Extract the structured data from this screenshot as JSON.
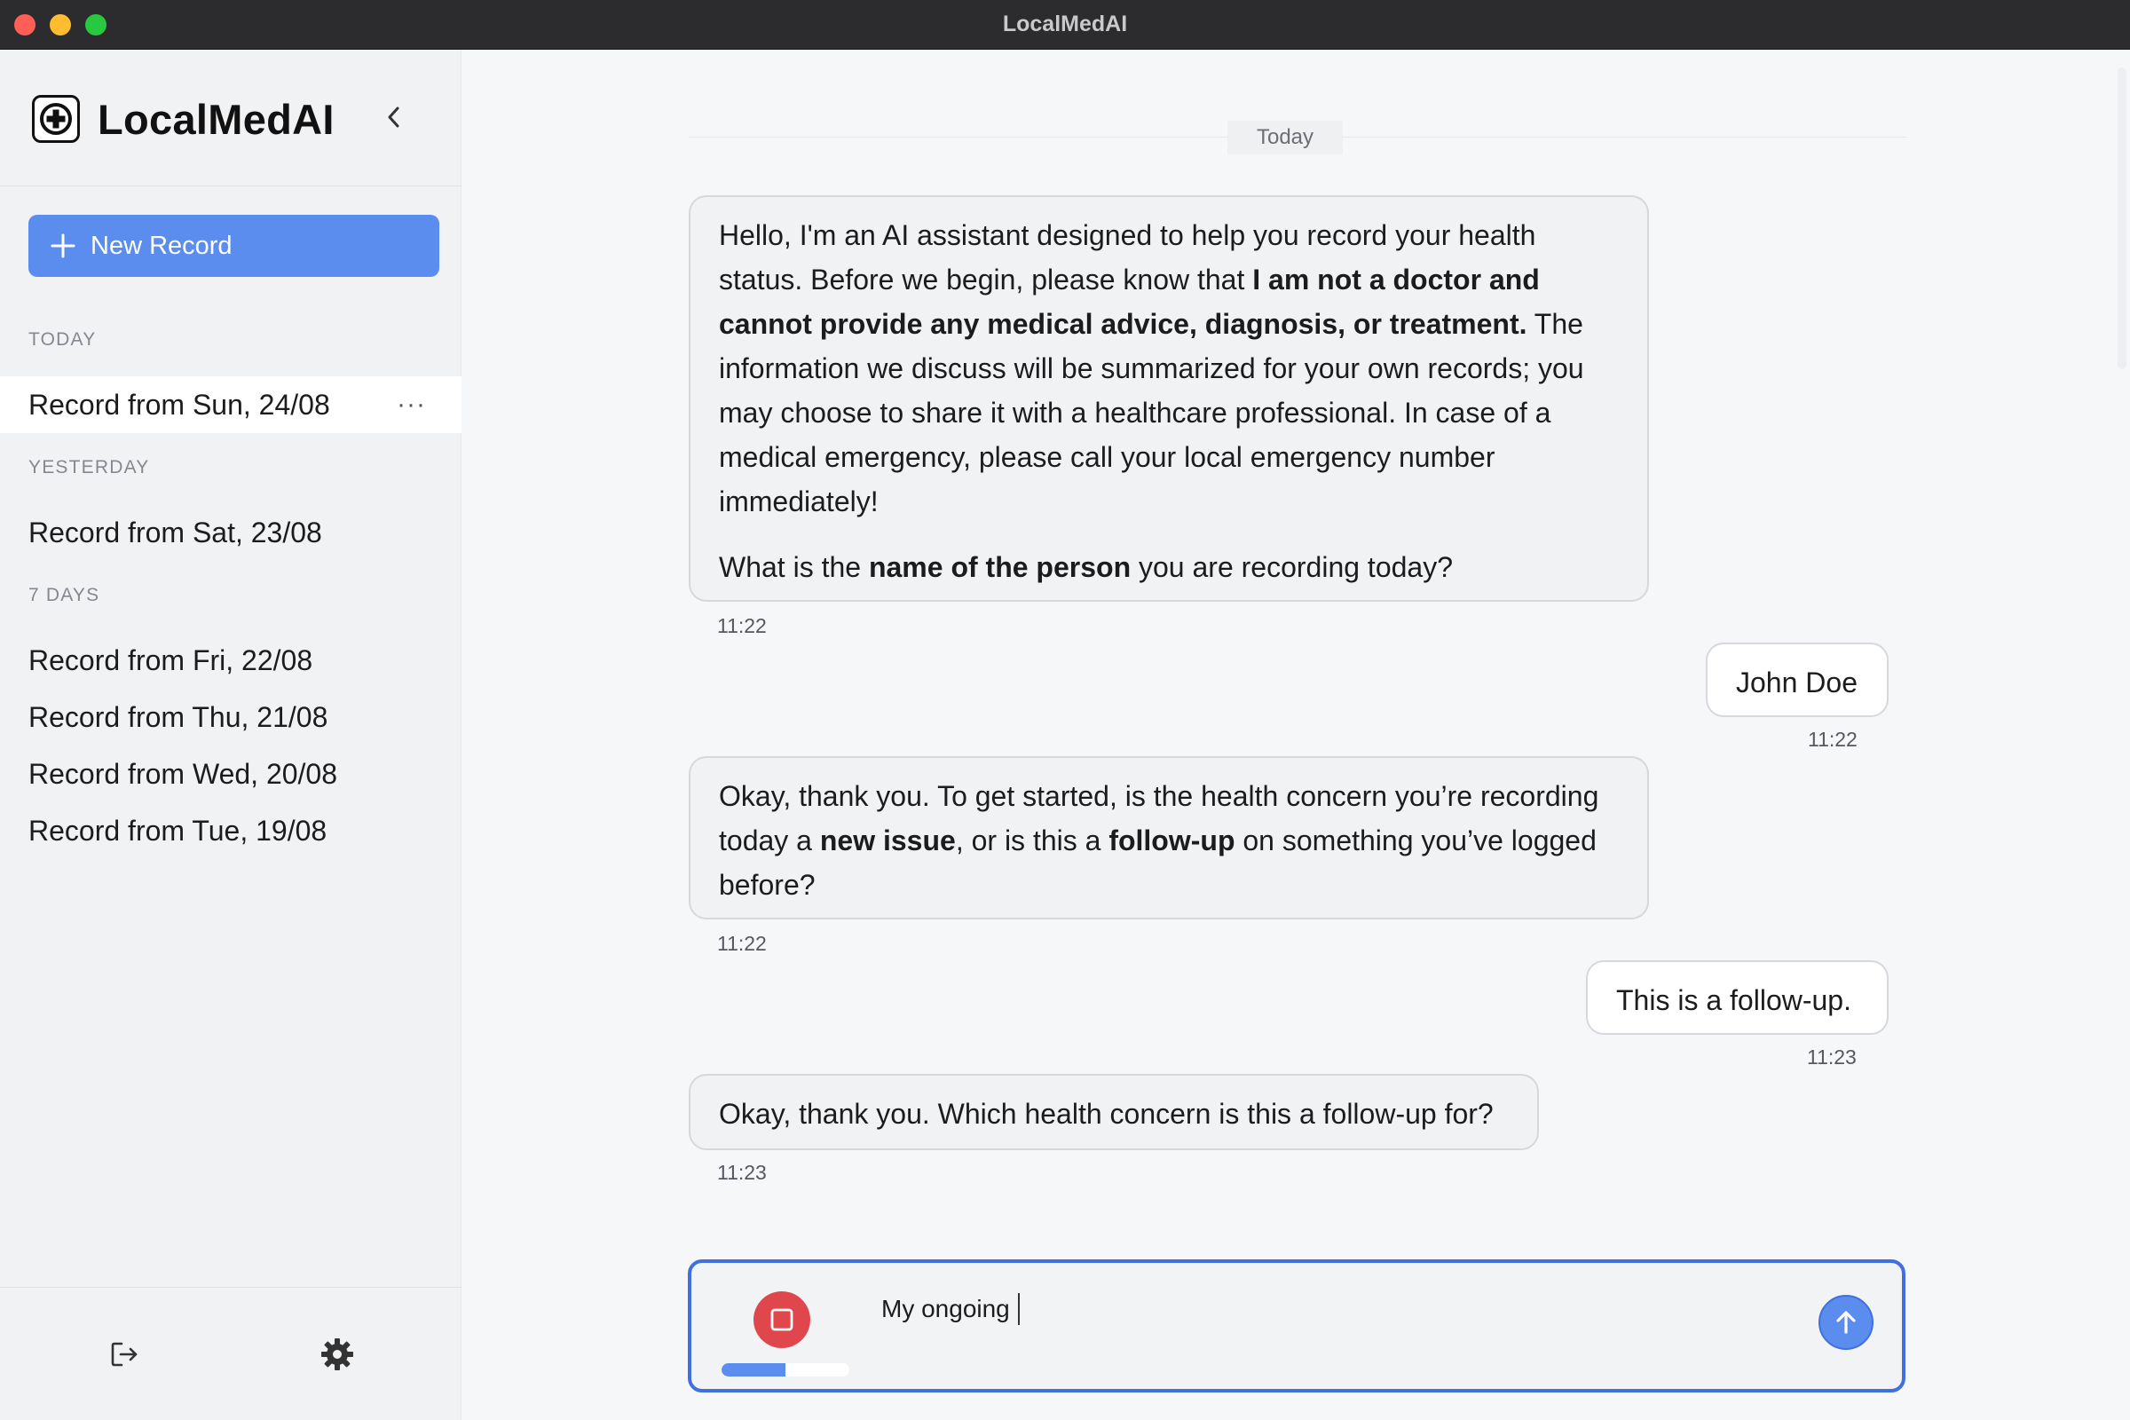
{
  "window": {
    "title": "LocalMedAI"
  },
  "sidebar": {
    "brand": "LocalMedAI",
    "new_record_label": "New Record",
    "sections": [
      {
        "label": "TODAY",
        "items": [
          {
            "label": "Record from Sun, 24/08",
            "more": "···"
          }
        ]
      },
      {
        "label": "YESTERDAY",
        "items": [
          {
            "label": "Record from Sat, 23/08"
          }
        ]
      },
      {
        "label": "7 DAYS",
        "items": [
          {
            "label": "Record from Fri, 22/08"
          },
          {
            "label": "Record from Thu, 21/08"
          },
          {
            "label": "Record from Wed, 20/08"
          },
          {
            "label": "Record from Tue, 19/08"
          }
        ]
      }
    ],
    "icons": {
      "brand": "medical-cross-icon",
      "collapse": "chevron-left-icon",
      "logout": "logout-icon",
      "settings": "gear-icon"
    }
  },
  "chat": {
    "date_separator": "Today",
    "messages": [
      {
        "role": "assistant",
        "p1": {
          "a": "Hello, I'm an AI assistant designed to help you record your health status. Before we begin, please know that ",
          "b": "I am not a doctor and cannot provide any medical advice, diagnosis, or treatment.",
          "c": " The information we discuss will be summarized for your own records; you may choose to share it with a healthcare professional. In case of a medical emergency, please call your local emergency number immediately!"
        },
        "p2": {
          "a": "What is the ",
          "b": "name of the person",
          "c": " you are recording today?"
        },
        "time": "11:22"
      },
      {
        "role": "user",
        "text": "John Doe",
        "time": "11:22"
      },
      {
        "role": "assistant",
        "p1": {
          "a": "Okay, thank you. To get started, is the health concern you’re recording today a ",
          "b": "new issue",
          "c": ", or is this a ",
          "d": "follow-up",
          "e": " on something you’ve logged before?"
        },
        "time": "11:22"
      },
      {
        "role": "user",
        "text": "This is a follow-up.",
        "time": "11:23"
      },
      {
        "role": "assistant",
        "text": "Okay, thank you. Which health concern is this a follow-up for?",
        "time": "11:23"
      }
    ]
  },
  "composer": {
    "value": "My ongoing",
    "recording_level": 0.5,
    "icons": {
      "stop": "stop-icon",
      "send": "arrow-up-icon"
    }
  },
  "colors": {
    "accent": "#5b8def",
    "focus": "#3f6fe0",
    "stop": "#e0474c"
  }
}
